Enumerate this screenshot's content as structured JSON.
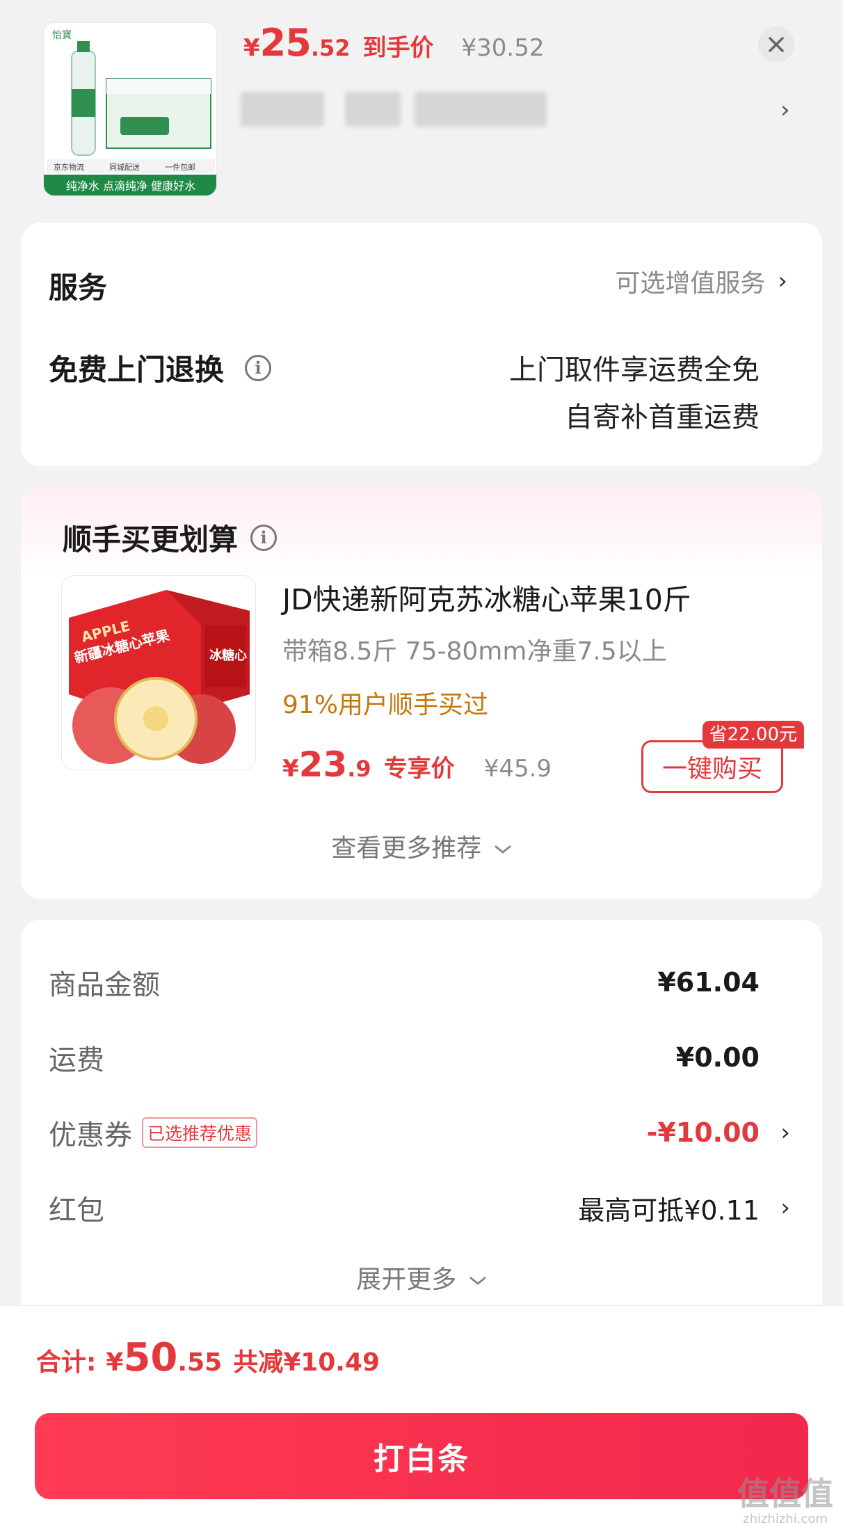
{
  "top_product": {
    "currency": "¥",
    "price_int": "25",
    "price_dec": ".52",
    "price_tag": "到手价",
    "original_price": "¥30.52",
    "image_text": {
      "brand": "怡寶",
      "strip_items": [
        "京东物流",
        "同城配送",
        "一件包邮"
      ],
      "slogan": "纯净水 点滴纯净 健康好水"
    }
  },
  "service": {
    "title": "服务",
    "optional_label": "可选增值服务",
    "free_return_title": "免费上门退换",
    "free_return_line1": "上门取件享运费全免",
    "free_return_line2": "自寄补首重运费"
  },
  "recommend": {
    "title": "顺手买更划算",
    "product_name": "JD快递新阿克苏冰糖心苹果10斤",
    "spec": "带箱8.5斤 75-80mm净重7.5以上",
    "buy_rate": "91%用户顺手买过",
    "currency": "¥",
    "price_int": "23",
    "price_dec": ".9",
    "price_tag": "专享价",
    "original_price": "¥45.9",
    "save_badge": "省22.00元",
    "buy_button": "一键购买",
    "more_label": "查看更多推荐",
    "image_text": {
      "apple_en": "APPLE",
      "box_title": "新疆冰糖心苹果",
      "side": "冰糖心"
    }
  },
  "fees": {
    "goods_label": "商品金额",
    "goods_value": "¥61.04",
    "shipping_label": "运费",
    "shipping_value": "¥0.00",
    "coupon_label": "优惠券",
    "coupon_tag": "已选推荐优惠",
    "coupon_value": "-¥10.00",
    "redpacket_label": "红包",
    "redpacket_value": "最高可抵¥0.11",
    "expand_label": "展开更多"
  },
  "footer": {
    "total_label": "合计:",
    "currency": "¥",
    "total_int": "50",
    "total_dec": ".55",
    "saved": "共减¥10.49",
    "pay_button": "打白条",
    "watermark_main": "值值值",
    "watermark_url": "zhizhizhi.com"
  },
  "colors": {
    "accent_red": "#e4393c",
    "orange": "#c6760b",
    "pay_gradient_start": "#ff3b52",
    "pay_gradient_end": "#f2274d"
  },
  "icons": [
    "close-icon",
    "chevron-right-icon",
    "info-icon",
    "chevron-down-icon"
  ]
}
